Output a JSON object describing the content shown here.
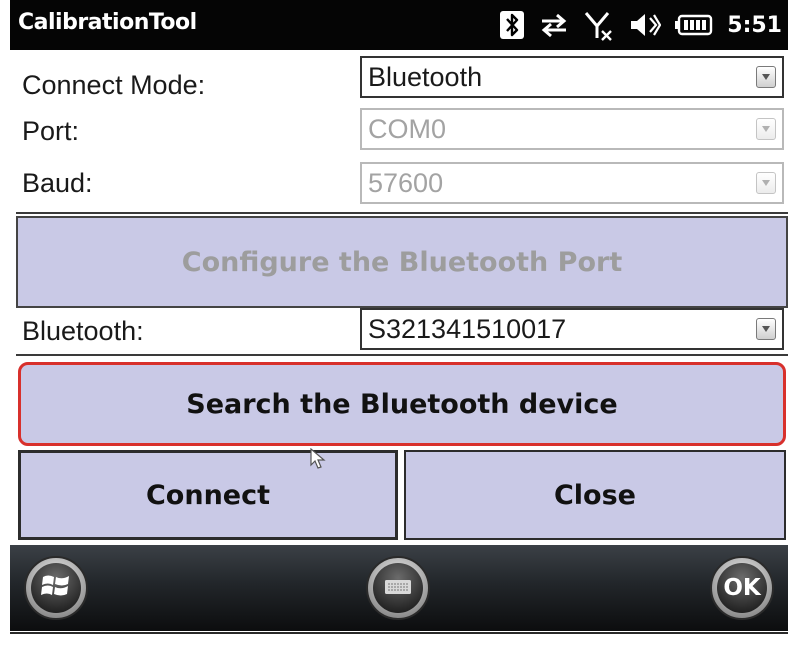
{
  "window": {
    "title": "CalibrationTool",
    "clock": "5:51"
  },
  "status_icons": [
    "bluetooth-icon",
    "sync-arrows-icon",
    "no-signal-icon",
    "speaker-icon",
    "battery-icon"
  ],
  "form": {
    "connect_mode": {
      "label": "Connect Mode:",
      "value": "Bluetooth"
    },
    "port": {
      "label": "Port:",
      "value": "COM0"
    },
    "baud": {
      "label": "Baud:",
      "value": "57600"
    },
    "bluetooth": {
      "label": "Bluetooth:",
      "value": "S321341510017"
    }
  },
  "buttons": {
    "configure": "Configure the Bluetooth Port",
    "search": "Search the Bluetooth device",
    "connect": "Connect",
    "close": "Close"
  },
  "softkeys": {
    "start_icon": "windows-logo-icon",
    "keyboard_icon": "keyboard-icon",
    "ok": "OK"
  },
  "colors": {
    "button_fill": "#c9c9e6",
    "focus_border": "#d8302c",
    "title_bar": "#050505"
  }
}
